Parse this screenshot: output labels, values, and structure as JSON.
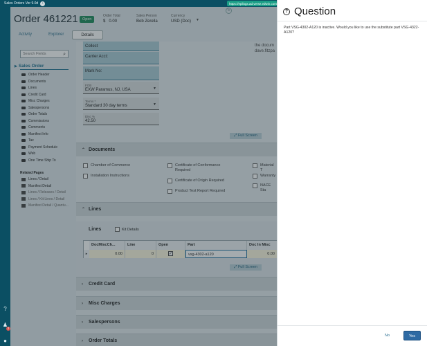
{
  "window": {
    "title": "Sales Orders Ver 9.0d",
    "url": "https://epilogx.ad.verse.edwin.com"
  },
  "header": {
    "order_title": "Order 461221",
    "status": "Open",
    "order_total_label": "Order Total",
    "order_total_currency": "$",
    "order_total_value": "0.00",
    "sales_person_label": "Sales Person",
    "sales_person_value": "Bob Zerella",
    "currency_label": "Currency",
    "currency_value": "USD (Doc)"
  },
  "tabs": [
    {
      "label": "Activity"
    },
    {
      "label": "Explorer"
    },
    {
      "label": "Details"
    }
  ],
  "sidebar": {
    "search_placeholder": "Search Fields",
    "section_label": "Sales Order",
    "items": [
      "Order Header",
      "Documents",
      "Lines",
      "Credit Card",
      "Misc Charges",
      "Salespersons",
      "Order Totals",
      "Commissions",
      "Comments",
      "Manifest Info",
      "Tax",
      "Payment Schedule",
      "Web",
      "One Time Ship To"
    ],
    "related_label": "Related Pages",
    "related_items": [
      "Lines / Detail",
      "Manifest Detail",
      "Lines / Releases / Detail",
      "Lines / Kit Lines / Detail",
      "Manifest Detail / Quantu..."
    ]
  },
  "form": {
    "collect_value": "Collect",
    "carrier_acct_label": "Carrier Acct:",
    "mark_no_label": "Mark No:",
    "fob_label": "FOB",
    "fob_value": "EXW Paramus, NJ, USA",
    "terms_label": "Terms *",
    "terms_value": "Standard 30 day terms",
    "disc_label": "Disc %",
    "disc_value": "42.50",
    "notes_line1": "the docum",
    "notes_line2": "dave.fitzpa",
    "full_screen_label": "Full Screen"
  },
  "documents": {
    "title": "Documents",
    "checkboxes": [
      "Chamber of Commerce",
      "Installation Instructions",
      "Certificate of Conformance Required",
      "Certificate of Origin Required",
      "Product Test Report Required",
      "Material T",
      "Warranty",
      "NACE Sta"
    ]
  },
  "lines": {
    "title": "Lines",
    "panel_label": "Lines",
    "kit_details_label": "Kit Details",
    "columns": [
      "DocMiscCh...",
      "Line",
      "Open",
      "Part",
      "Doc In Misc",
      "Pa"
    ],
    "row": {
      "doc_misc": "0.00",
      "line": "0",
      "part": "vsg-4302-a120",
      "doc_in_misc": "0.00"
    },
    "full_screen_label": "Full Screen"
  },
  "collapsed_sections": [
    "Credit Card",
    "Misc Charges",
    "Salespersons",
    "Order Totals"
  ],
  "dialog": {
    "title": "Question",
    "message": "Part VSG-4302-A120 is inactive. Would you like to use the substitute part VSG-4322-A120?",
    "no_label": "No",
    "yes_label": "Yes"
  },
  "notifications": {
    "badge_count": "2"
  }
}
